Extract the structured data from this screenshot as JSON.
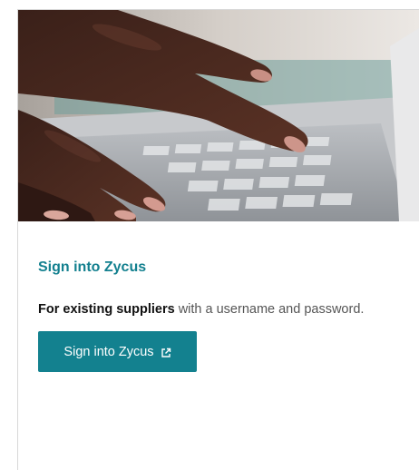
{
  "card": {
    "title": "Sign into Zycus",
    "description_bold": "For existing suppliers",
    "description_rest": " with a username and password.",
    "button_label": "Sign into Zycus",
    "button_icon": "external-link-icon",
    "hero_image": "hands-typing-on-laptop-keyboard"
  },
  "colors": {
    "accent": "#13808f",
    "button_bg": "#13818f",
    "button_text": "#ffffff",
    "body_text": "#555555",
    "strong_text": "#111111"
  }
}
